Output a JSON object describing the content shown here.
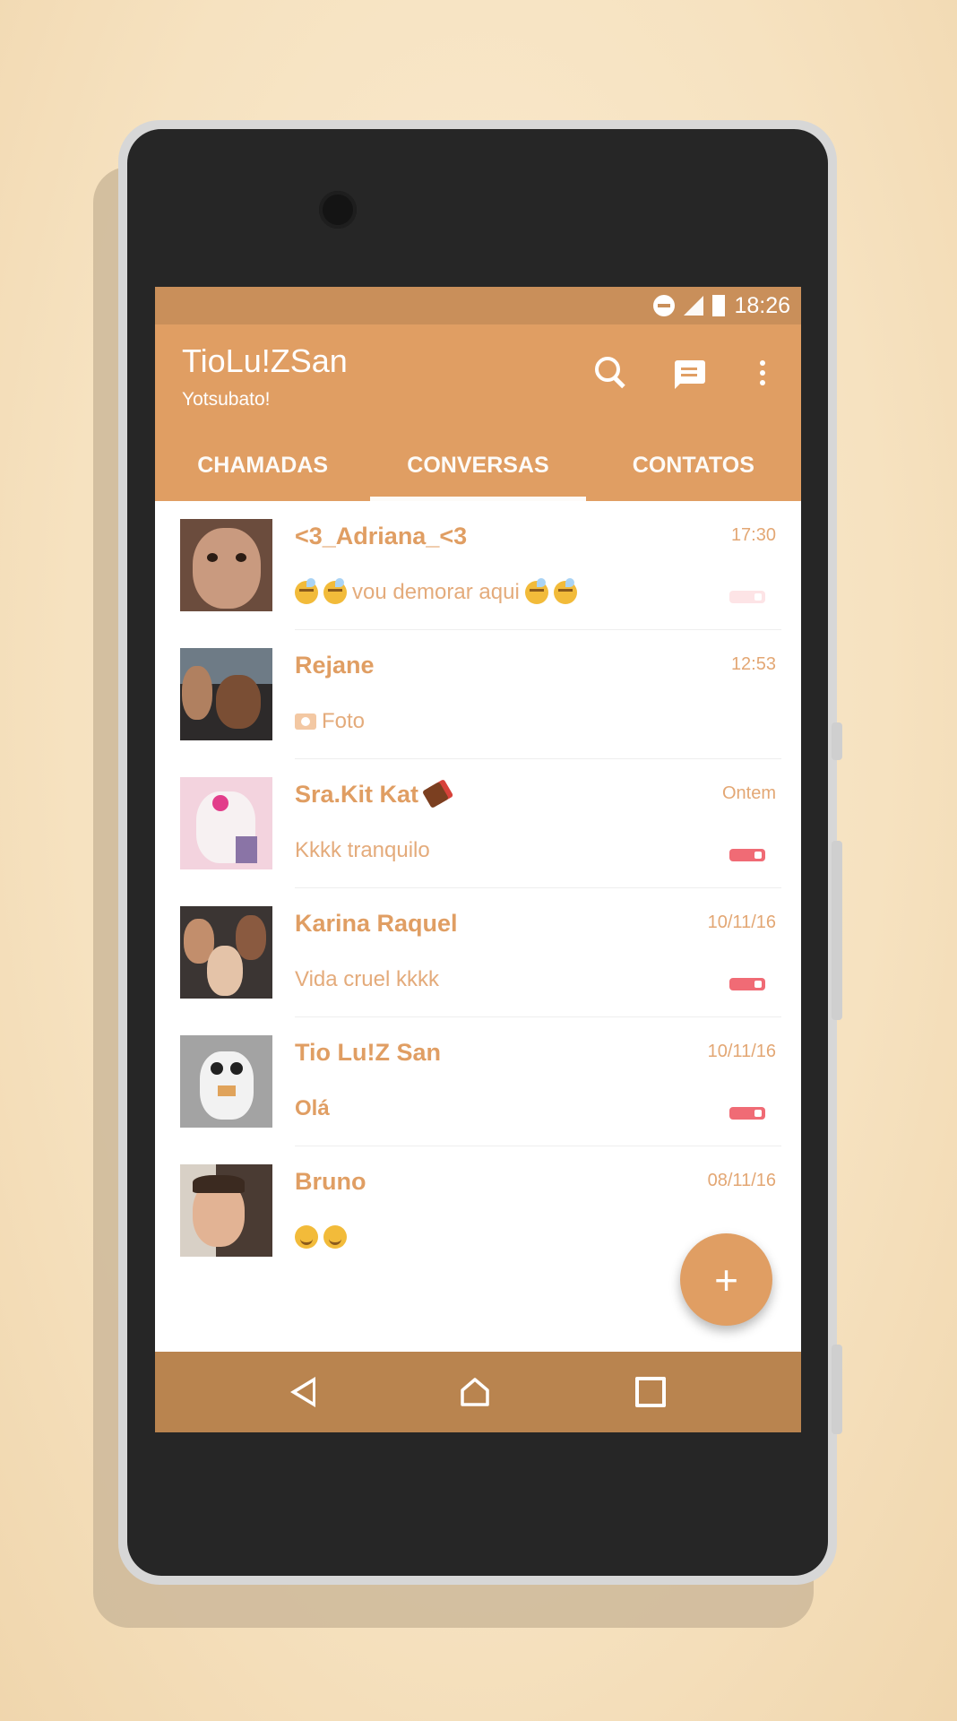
{
  "status_bar": {
    "time": "18:26",
    "icons": [
      "do-not-disturb-icon",
      "signal-icon",
      "battery-icon"
    ]
  },
  "app_bar": {
    "title": "TioLu!ZSan",
    "subtitle": "Yotsubato!",
    "actions": [
      "search-icon",
      "compose-icon",
      "more-vert-icon"
    ]
  },
  "tabs": [
    {
      "label": "CHAMADAS",
      "active": false
    },
    {
      "label": "CONVERSAS",
      "active": true
    },
    {
      "label": "CONTATOS",
      "active": false
    }
  ],
  "chats": [
    {
      "name": "<3_Adriana_<3",
      "time": "17:30",
      "preview_text": "vou demorar aqui",
      "preview_icons": [
        "sleepy-emoji",
        "sleepy-emoji",
        "sleepy-emoji",
        "sleepy-emoji"
      ]
    },
    {
      "name": "Rejane",
      "time": "12:53",
      "preview_text": "Foto",
      "preview_icons": [
        "camera-icon"
      ]
    },
    {
      "name": "Sra.Kit Kat",
      "time": "Ontem",
      "preview_text": "Kkkk tranquilo",
      "name_icon": "chocolate-emoji"
    },
    {
      "name": "Karina Raquel",
      "time": "10/11/16",
      "preview_text": "Vida cruel kkkk"
    },
    {
      "name": "Tio Lu!Z San",
      "time": "10/11/16",
      "preview_text": "Olá"
    },
    {
      "name": "Bruno",
      "time": "08/11/16",
      "preview_text": "",
      "preview_icons": [
        "smirk-emoji",
        "smirk-emoji"
      ]
    }
  ],
  "fab": {
    "label": "+"
  },
  "nav_bar": [
    "back-icon",
    "home-icon",
    "recents-icon"
  ],
  "colors": {
    "primary": "#e09e63",
    "status_bar": "#c98f5a",
    "nav_bar": "#b9844f",
    "indicator": "#f06b75"
  }
}
